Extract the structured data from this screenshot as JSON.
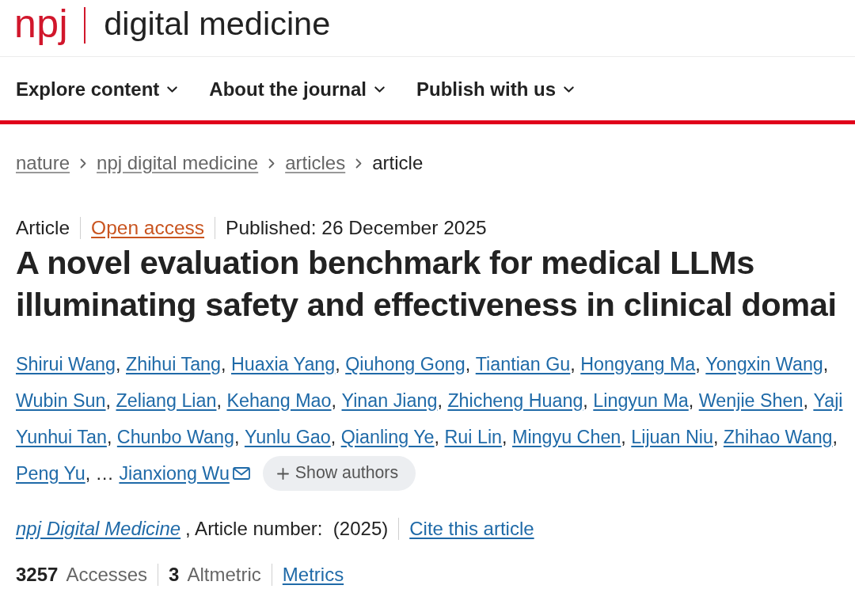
{
  "header": {
    "logo": {
      "brand": "npj",
      "name": "digital medicine"
    }
  },
  "nav": {
    "items": [
      {
        "label": "Explore content",
        "expanded": false
      },
      {
        "label": "About the journal",
        "expanded": false
      },
      {
        "label": "Publish with us",
        "expanded": false
      }
    ]
  },
  "breadcrumbs": [
    {
      "label": "nature",
      "current": false
    },
    {
      "label": "npj digital medicine",
      "current": false
    },
    {
      "label": "articles",
      "current": false
    },
    {
      "label": "article",
      "current": true
    }
  ],
  "article": {
    "type": "Article",
    "access": "Open access",
    "published": "Published: 26 December 2025",
    "title": "A novel evaluation benchmark for medical LLMs illuminating safety and effectiveness in clinical domai",
    "authors": {
      "lines": [
        [
          {
            "name": "Shirui Wang",
            "after": ",",
            "email": false
          },
          {
            "name": "Zhihui Tang",
            "after": ",",
            "email": false
          },
          {
            "name": "Huaxia Yang",
            "after": ",",
            "email": false
          },
          {
            "name": "Qiuhong Gong",
            "after": ",",
            "email": false
          },
          {
            "name": "Tiantian Gu",
            "after": ",",
            "email": false
          },
          {
            "name": "Hongyang Ma",
            "after": ",",
            "email": false
          },
          {
            "name": "Yongxin Wang",
            "after": ",",
            "email": false
          }
        ],
        [
          {
            "name": "Wubin Sun",
            "after": ",",
            "email": false
          },
          {
            "name": "Zeliang Lian",
            "after": ",",
            "email": false
          },
          {
            "name": "Kehang Mao",
            "after": ",",
            "email": false
          },
          {
            "name": "Yinan Jiang",
            "after": ",",
            "email": false
          },
          {
            "name": "Zhicheng Huang",
            "after": ",",
            "email": false
          },
          {
            "name": "Lingyun Ma",
            "after": ",",
            "email": false
          },
          {
            "name": "Wenjie Shen",
            "after": ",",
            "email": false
          },
          {
            "name": "Yaji",
            "email": false
          }
        ],
        [
          {
            "name": "Yunhui Tan",
            "after": ",",
            "email": false
          },
          {
            "name": "Chunbo Wang",
            "after": ",",
            "email": false
          },
          {
            "name": "Yunlu Gao",
            "after": ",",
            "email": false
          },
          {
            "name": "Qianling Ye",
            "after": ",",
            "email": false
          },
          {
            "name": "Rui Lin",
            "after": ",",
            "email": false
          },
          {
            "name": "Mingyu Chen",
            "after": ",",
            "email": false
          },
          {
            "name": "Lijuan Niu",
            "after": ",",
            "email": false
          },
          {
            "name": "Zhihao Wang",
            "after": ",",
            "email": false
          }
        ],
        [
          {
            "name": "Peng Yu",
            "after": ", …",
            "email": false
          },
          {
            "name": "Jianxiong Wu",
            "email": true
          }
        ]
      ],
      "show_authors": {
        "label": "Show authors"
      }
    },
    "citation": {
      "journal": "npj Digital Medicine",
      "details": ", Article number:  (2025)",
      "cite": "Cite this article"
    },
    "metrics": {
      "accesses": {
        "value": "3257",
        "label": "Accesses"
      },
      "altmetric": {
        "value": "3",
        "label": "Altmetric"
      },
      "link": "Metrics"
    }
  }
}
